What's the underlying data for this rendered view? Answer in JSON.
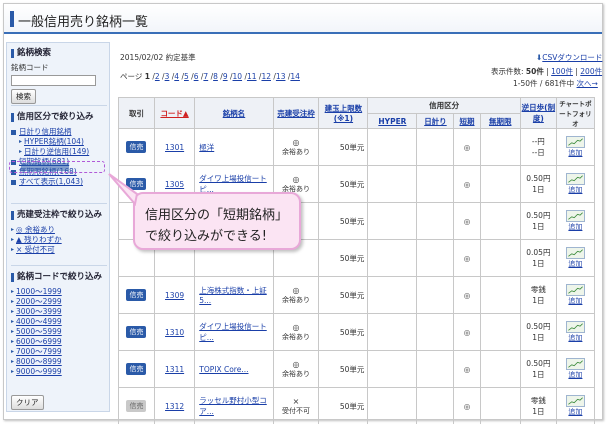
{
  "title": "一般信用売り銘柄一覧",
  "sidebar": {
    "search_heading": "銘柄検索",
    "code_label": "銘柄コード",
    "search_button": "検索",
    "credit_heading": "信用区分で絞り込み",
    "credit_items": [
      {
        "label": "日計り信用銘柄"
      },
      {
        "label": "HYPER銘柄(104)",
        "indent": true
      },
      {
        "label": "日計り逆信用(149)",
        "indent": true
      },
      {
        "label": "短期銘柄(681)"
      },
      {
        "label": "無期限銘柄(168)"
      },
      {
        "label": "すべて表示(1,043)"
      }
    ],
    "acceptance_heading": "売建受注枠で絞り込み",
    "acceptance_items": [
      "◎ 余裕あり",
      "▲ 残りわずか",
      "× 受付不可"
    ],
    "code_heading": "銘柄コードで絞り込み",
    "code_ranges": [
      "1000〜1999",
      "2000〜2999",
      "3000〜3999",
      "4000〜4999",
      "5000〜5999",
      "6000〜6999",
      "7000〜7999",
      "8000〜8999",
      "9000〜9999"
    ],
    "clear_button": "クリア"
  },
  "main": {
    "date_basis": "2015/02/02  約定基準",
    "csv_download": "CSVダウンロード",
    "page_label": "ページ",
    "pages": [
      "1",
      "2",
      "3",
      "4",
      "5",
      "6",
      "7",
      "8",
      "9",
      "10",
      "11",
      "12",
      "13",
      "14"
    ],
    "display_count_label": "表示件数: ",
    "display_count_current": "50件",
    "display_count_100": "100件",
    "display_count_200": "200件",
    "range_text": "1-50件 / 681件中",
    "next_label": "次へ→"
  },
  "table": {
    "headers": {
      "trade": "取引",
      "code": "コード▲",
      "name": "銘柄名",
      "short_order": "売建受注枠",
      "upper_limit": "建玉上限数(※1)",
      "credit_division": "信用区分",
      "hyper": "HYPER",
      "day_trade": "日計り",
      "short_term": "短期",
      "no_limit": "無期限",
      "reverse_fee": "逆日歩(制度)",
      "chart": "チャートポートフォリオ"
    },
    "rows": [
      {
        "badge": "信売",
        "code": "1301",
        "name": "極洋",
        "order": "◎",
        "order_note": "余裕あり",
        "limit": "50単元",
        "hyper": "",
        "day": "",
        "short": "◎",
        "nolimit": "",
        "fee": "--円",
        "days": "--日",
        "add": "追加",
        "disabled": false
      },
      {
        "badge": "信売",
        "code": "1305",
        "name": "ダイワ上場投信ートピ...",
        "order": "◎",
        "order_note": "余裕あり",
        "limit": "50単元",
        "hyper": "",
        "day": "",
        "short": "◎",
        "nolimit": "",
        "fee": "0.50円",
        "days": "1日",
        "add": "追加",
        "disabled": false
      },
      {
        "badge": "",
        "code": "",
        "name": "",
        "order": "",
        "order_note": "",
        "limit": "50単元",
        "hyper": "",
        "day": "",
        "short": "◎",
        "nolimit": "",
        "fee": "0.50円",
        "days": "1日",
        "add": "追加",
        "disabled": false
      },
      {
        "badge": "",
        "code": "",
        "name": "",
        "order": "",
        "order_note": "",
        "limit": "50単元",
        "hyper": "",
        "day": "",
        "short": "◎",
        "nolimit": "",
        "fee": "0.05円",
        "days": "1日",
        "add": "追加",
        "disabled": false
      },
      {
        "badge": "信売",
        "code": "1309",
        "name": "上海株式指数・上証5...",
        "order": "◎",
        "order_note": "余裕あり",
        "limit": "50単元",
        "hyper": "",
        "day": "",
        "short": "◎",
        "nolimit": "",
        "fee": "零銭",
        "days": "1日",
        "add": "追加",
        "disabled": false
      },
      {
        "badge": "信売",
        "code": "1310",
        "name": "ダイワ上場投信ートピ...",
        "order": "◎",
        "order_note": "余裕あり",
        "limit": "50単元",
        "hyper": "",
        "day": "",
        "short": "◎",
        "nolimit": "",
        "fee": "0.50円",
        "days": "1日",
        "add": "追加",
        "disabled": false
      },
      {
        "badge": "信売",
        "code": "1311",
        "name": "TOPIX Core...",
        "order": "◎",
        "order_note": "余裕あり",
        "limit": "50単元",
        "hyper": "",
        "day": "",
        "short": "◎",
        "nolimit": "",
        "fee": "0.50円",
        "days": "1日",
        "add": "追加",
        "disabled": false
      },
      {
        "badge": "信売",
        "code": "1312",
        "name": "ラッセル野村小型コア...",
        "order": "×",
        "order_note": "受付不可",
        "limit": "50単元",
        "hyper": "",
        "day": "",
        "short": "◎",
        "nolimit": "",
        "fee": "零銭",
        "days": "1日",
        "add": "追加",
        "disabled": true
      }
    ]
  },
  "balloon": {
    "line1": "信用区分の「短期銘柄」",
    "line2": "で絞り込みができる!"
  }
}
